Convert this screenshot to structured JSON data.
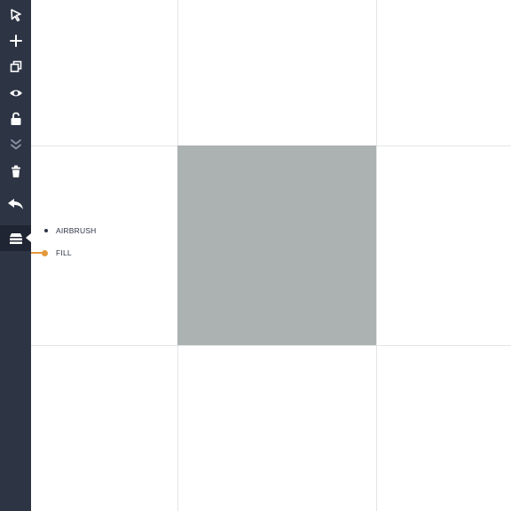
{
  "toolbar": {
    "tools": [
      {
        "id": "select",
        "icon": "cursor-arrow-icon"
      },
      {
        "id": "add",
        "icon": "plus-icon"
      },
      {
        "id": "duplicate",
        "icon": "duplicate-icon"
      },
      {
        "id": "visibility",
        "icon": "eye-icon"
      },
      {
        "id": "lock",
        "icon": "lock-icon"
      },
      {
        "id": "move-down",
        "icon": "double-chevron-down-icon"
      },
      {
        "id": "delete",
        "icon": "trash-icon"
      },
      {
        "id": "undo",
        "icon": "undo-arrow-icon"
      },
      {
        "id": "layers",
        "icon": "layers-icon",
        "active": true
      }
    ]
  },
  "layer_menu": {
    "items": [
      {
        "label": "AIRBRUSH",
        "selected": false
      },
      {
        "label": "FILL",
        "selected": true
      }
    ]
  },
  "canvas": {
    "shape_color": "#abb2b1",
    "grid_color": "#e3e5e7"
  },
  "colors": {
    "toolbar_bg": "#2d3444",
    "accent": "#e49a3a"
  }
}
